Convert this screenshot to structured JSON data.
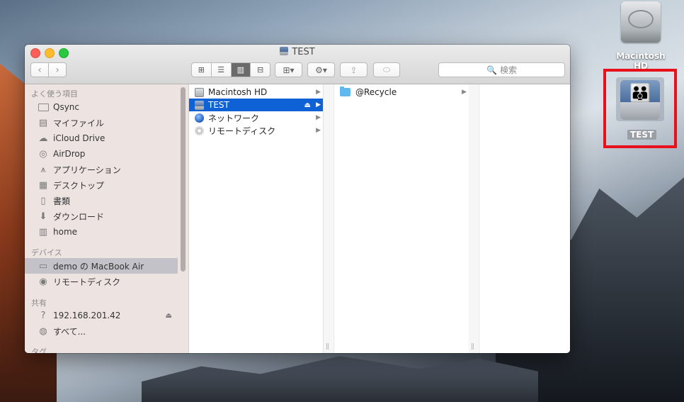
{
  "desktop": {
    "icons": [
      {
        "label": "Macintosh HD"
      },
      {
        "label": "TEST"
      }
    ]
  },
  "window": {
    "title": "TEST",
    "toolbar": {
      "back_icon": "‹",
      "forward_icon": "›",
      "view_icons": [
        "⊞",
        "☰",
        "▥",
        "⊟"
      ],
      "arrange_icon": "⊞▾",
      "action_icon": "⚙▾",
      "share_icon": "⇪",
      "tag_icon": "⬭",
      "search_placeholder": "検索"
    },
    "sidebar": {
      "sections": [
        {
          "header": "よく使う項目",
          "items": [
            {
              "label": "Qsync",
              "icon": "folder-icon"
            },
            {
              "label": "マイファイル",
              "icon": "all-files-icon"
            },
            {
              "label": "iCloud Drive",
              "icon": "cloud-icon"
            },
            {
              "label": "AirDrop",
              "icon": "airdrop-icon"
            },
            {
              "label": "アプリケーション",
              "icon": "applications-icon"
            },
            {
              "label": "デスクトップ",
              "icon": "desktop-icon"
            },
            {
              "label": "書類",
              "icon": "documents-icon"
            },
            {
              "label": "ダウンロード",
              "icon": "downloads-icon"
            },
            {
              "label": "home",
              "icon": "home-icon"
            }
          ]
        },
        {
          "header": "デバイス",
          "items": [
            {
              "label": "demo の MacBook Air",
              "icon": "laptop-icon",
              "selected": true
            },
            {
              "label": "リモートディスク",
              "icon": "remote-disc-icon"
            }
          ]
        },
        {
          "header": "共有",
          "items": [
            {
              "label": "192.168.201.42",
              "icon": "unknown-server-icon",
              "eject": "⏏"
            },
            {
              "label": "すべて...",
              "icon": "network-icon"
            }
          ]
        },
        {
          "header": "タグ",
          "items": []
        }
      ]
    },
    "columns": [
      {
        "rows": [
          {
            "label": "Macintosh HD"
          },
          {
            "label": "TEST",
            "selected": true,
            "eject": "⏏"
          },
          {
            "label": "ネットワーク"
          },
          {
            "label": "リモートディスク"
          }
        ]
      },
      {
        "rows": [
          {
            "label": "@Recycle"
          }
        ]
      }
    ]
  }
}
